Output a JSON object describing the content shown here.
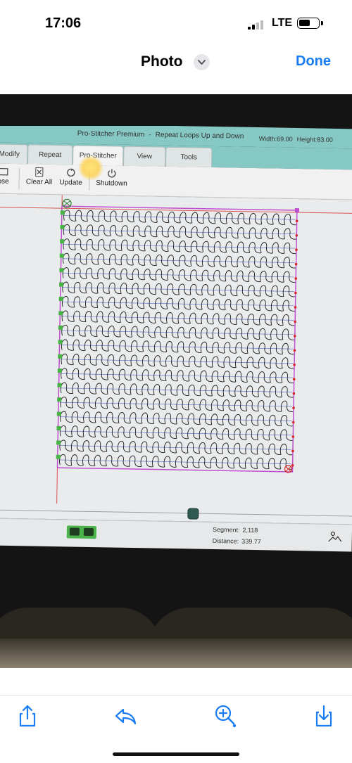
{
  "status_bar": {
    "time": "17:06",
    "network": "LTE",
    "icons": [
      "signal-icon",
      "battery-icon"
    ]
  },
  "nav_bar": {
    "title": "Photo",
    "done_label": "Done",
    "title_menu_icon": "chevron-down-icon"
  },
  "app": {
    "title": "Pro-Stitcher Premium",
    "separator": "-",
    "document": "Repeat Loops Up and Down",
    "width_label": "Width:69.00",
    "height_label": "Height:83.00",
    "tabs": [
      {
        "label": "Modify"
      },
      {
        "label": "Repeat"
      },
      {
        "label": "Pro-Stitcher"
      },
      {
        "label": "View"
      },
      {
        "label": "Tools"
      }
    ],
    "ribbon": {
      "close_label": "ose",
      "clear_all_label": "Clear All",
      "update_label": "Update",
      "shutdown_label": "Shutdown"
    },
    "status": {
      "segment_label": "Segment:",
      "segment_value": "2,118",
      "distance_label": "Distance:",
      "distance_value": "339.77"
    }
  },
  "pattern": {
    "rows": 18,
    "cols": 20,
    "line_color": "#1a1a1a",
    "border_color": "#c04fd0",
    "guide_color": "#d9534f",
    "handle_green": "#46b546",
    "handle_red": "#d9262b"
  },
  "toolbar": {
    "icons": [
      "share-icon",
      "reply-icon",
      "zoom-in-icon",
      "save-icon"
    ]
  },
  "colors": {
    "accent": "#1a7cf2",
    "app_bar": "#86c8c4"
  }
}
